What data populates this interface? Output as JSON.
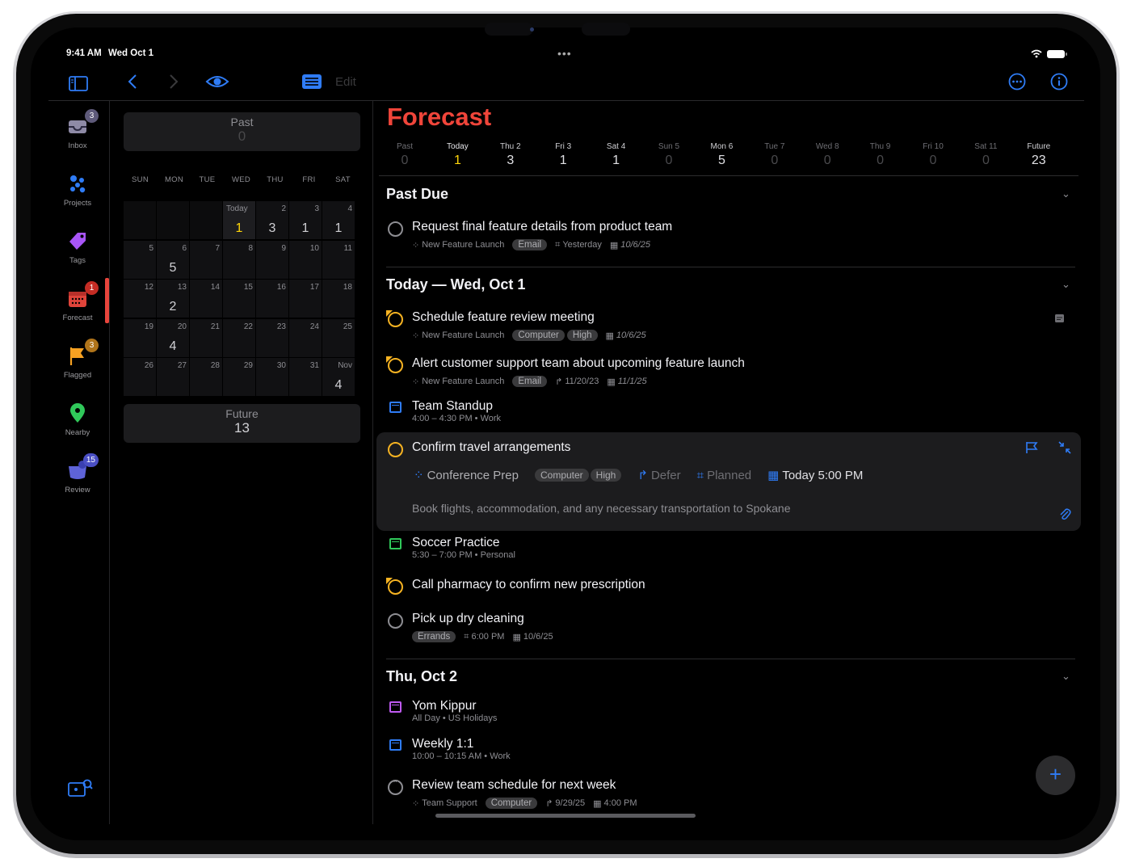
{
  "status": {
    "time": "9:41 AM",
    "date": "Wed Oct 1"
  },
  "toolbar": {
    "edit_label": "Edit"
  },
  "sidebar": {
    "items": [
      {
        "label": "Inbox",
        "badge": "3"
      },
      {
        "label": "Projects"
      },
      {
        "label": "Tags"
      },
      {
        "label": "Forecast",
        "badge": "1"
      },
      {
        "label": "Flagged",
        "badge": "3"
      },
      {
        "label": "Nearby"
      },
      {
        "label": "Review",
        "badge": "15"
      }
    ]
  },
  "calendar": {
    "past": {
      "label": "Past",
      "count": "0"
    },
    "future": {
      "label": "Future",
      "count": "13"
    },
    "weekdays": [
      "SUN",
      "MON",
      "TUE",
      "WED",
      "THU",
      "FRI",
      "SAT"
    ],
    "today_label": "Today",
    "row1": [
      {
        "d": "1",
        "c": "1"
      },
      {
        "d": "2",
        "c": "3"
      },
      {
        "d": "3",
        "c": "1"
      },
      {
        "d": "4",
        "c": "1"
      }
    ],
    "rows": [
      [
        {
          "d": "5"
        },
        {
          "d": "6",
          "c": "5"
        },
        {
          "d": "7"
        },
        {
          "d": "8"
        },
        {
          "d": "9"
        },
        {
          "d": "10"
        },
        {
          "d": "11"
        }
      ],
      [
        {
          "d": "12"
        },
        {
          "d": "13",
          "c": "2"
        },
        {
          "d": "14"
        },
        {
          "d": "15"
        },
        {
          "d": "16"
        },
        {
          "d": "17"
        },
        {
          "d": "18"
        }
      ],
      [
        {
          "d": "19"
        },
        {
          "d": "20",
          "c": "4"
        },
        {
          "d": "21"
        },
        {
          "d": "22"
        },
        {
          "d": "23"
        },
        {
          "d": "24"
        },
        {
          "d": "25"
        }
      ],
      [
        {
          "d": "26"
        },
        {
          "d": "27"
        },
        {
          "d": "28"
        },
        {
          "d": "29"
        },
        {
          "d": "30"
        },
        {
          "d": "31"
        },
        {
          "d": "Nov",
          "c": "4"
        }
      ]
    ]
  },
  "main": {
    "title": "Forecast",
    "strip": [
      {
        "label": "Past",
        "n": "0"
      },
      {
        "label": "Today",
        "n": "1"
      },
      {
        "label": "Thu 2",
        "n": "3"
      },
      {
        "label": "Fri 3",
        "n": "1"
      },
      {
        "label": "Sat 4",
        "n": "1"
      },
      {
        "label": "Sun 5",
        "n": "0"
      },
      {
        "label": "Mon 6",
        "n": "5"
      },
      {
        "label": "Tue 7",
        "n": "0"
      },
      {
        "label": "Wed 8",
        "n": "0"
      },
      {
        "label": "Thu 9",
        "n": "0"
      },
      {
        "label": "Fri 10",
        "n": "0"
      },
      {
        "label": "Sat 11",
        "n": "0"
      },
      {
        "label": "Future",
        "n": "23"
      }
    ],
    "sections": {
      "past_due": "Past Due",
      "today": "Today — Wed, Oct 1",
      "thu": "Thu, Oct 2"
    },
    "tasks": {
      "t1": {
        "title": "Request final feature details from product team",
        "project": "New Feature Launch",
        "tag": "Email",
        "planned": "Yesterday",
        "due": "10/6/25"
      },
      "t2": {
        "title": "Schedule feature review meeting",
        "project": "New Feature Launch",
        "tag1": "Computer",
        "tag2": "High",
        "due": "10/6/25"
      },
      "t3": {
        "title": "Alert customer support team about upcoming feature launch",
        "project": "New Feature Launch",
        "tag": "Email",
        "defer": "11/20/23",
        "due": "11/1/25"
      },
      "e1": {
        "title": "Team Standup",
        "sub": "4:00 – 4:30 PM • Work"
      },
      "t4": {
        "title": "Confirm travel arrangements",
        "project": "Conference Prep",
        "tag1": "Computer",
        "tag2": "High",
        "defer": "Defer",
        "planned": "Planned",
        "due": "Today 5:00 PM",
        "note": "Book flights, accommodation, and any necessary transportation to Spokane"
      },
      "e2": {
        "title": "Soccer Practice",
        "sub": "5:30 – 7:00 PM • Personal"
      },
      "t5": {
        "title": "Call pharmacy to confirm new prescription"
      },
      "t6": {
        "title": "Pick up dry cleaning",
        "tag": "Errands",
        "planned": "6:00 PM",
        "due": "10/6/25"
      },
      "e3": {
        "title": "Yom Kippur",
        "sub": "All Day • US Holidays"
      },
      "e4": {
        "title": "Weekly 1:1",
        "sub": "10:00 – 10:15 AM • Work"
      },
      "t7": {
        "title": "Review team schedule for next week",
        "project": "Team Support",
        "tag": "Computer",
        "defer": "9/29/25",
        "due": "4:00 PM"
      }
    }
  },
  "colors": {
    "accent": "#2f7cf6",
    "forecast": "#f0453a",
    "flag": "#f6b322",
    "today": "#ffd60a"
  }
}
